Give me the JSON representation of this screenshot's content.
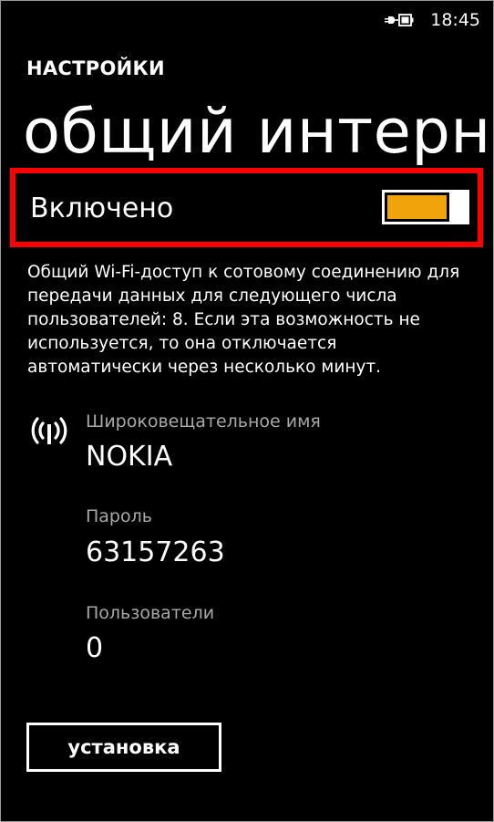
{
  "status_bar": {
    "battery_icon": "charging-battery-icon",
    "time": "18:45"
  },
  "header": {
    "app_title": "НАСТРОЙКИ",
    "page_title": "общий интерн"
  },
  "toggle": {
    "label": "Включено",
    "on": true,
    "accent_color": "#f0a30a",
    "highlight_color": "#ff0000"
  },
  "description": "Общий Wi-Fi-доступ к сотовому соединению для передачи данных для следующего числа пользователей: 8. Если эта возможность не используется, то она отключается автоматически через несколько минут.",
  "network": {
    "icon": "wifi-broadcast-icon",
    "broadcast_name_label": "Широковещательное имя",
    "broadcast_name_value": "NOKIA",
    "password_label": "Пароль",
    "password_value": "63157263",
    "users_label": "Пользователи",
    "users_value": "0"
  },
  "setup_button": {
    "label": "установка"
  }
}
